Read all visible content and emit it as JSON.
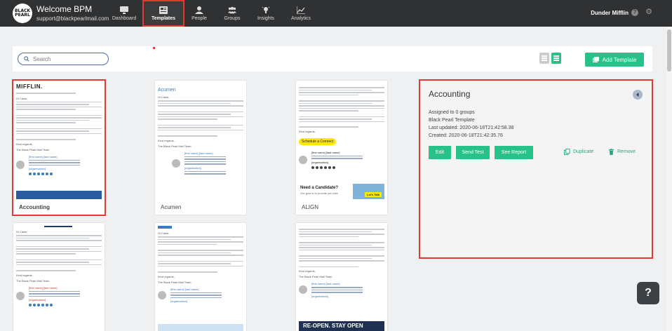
{
  "header": {
    "logo_text": "BLACK PEARL",
    "welcome": "Welcome BPM",
    "email": "support@blackpearlmail.com",
    "nav": [
      {
        "label": "Dashboard",
        "icon": "monitor-icon"
      },
      {
        "label": "Templates",
        "icon": "template-icon",
        "active": true
      },
      {
        "label": "People",
        "icon": "person-icon"
      },
      {
        "label": "Groups",
        "icon": "groups-icon"
      },
      {
        "label": "Insights",
        "icon": "lightbulb-icon"
      },
      {
        "label": "Analytics",
        "icon": "chart-line-icon"
      }
    ],
    "org": "Dunder Mifflin",
    "help": "?",
    "settings_icon": "gear-icon"
  },
  "toolbar": {
    "search_placeholder": "Search",
    "add_label": "Add Template",
    "view_modes": [
      "list-view",
      "grid-view"
    ],
    "active_view": "grid-view"
  },
  "templates": [
    {
      "name": "Accounting",
      "logo": "MIFFLIN.",
      "selected": true
    },
    {
      "name": "Acumen",
      "logo": "Acumen"
    },
    {
      "name": "ALIGN",
      "cta": "Schedule a Connect",
      "promo": "Need a Candidate?",
      "promo_sub": "Our goal is to provide you with",
      "promo_btn": "Let's Talk"
    },
    {
      "name": "",
      "logo": ""
    },
    {
      "name": "",
      "logo": ""
    },
    {
      "name": "",
      "banner": "RE-OPEN. STAY OPEN"
    }
  ],
  "thumb_text": {
    "greeting": "Hi Claire,",
    "regards": "Kind regards,",
    "team": "The Black Pearl Mail Team",
    "sig_name": "[first name] [last name]",
    "sig_org": "[organisation]"
  },
  "detail": {
    "title": "Accounting",
    "assigned": "Assigned to 0 groups",
    "type": "Black Pearl Template",
    "updated": "Last updated: 2020-06-18T21:42:58.38",
    "created": "Created: 2020-06-18T21:42:35.76",
    "edit": "Edit",
    "send_test": "Send Test",
    "see_report": "See Report",
    "duplicate": "Duplicate",
    "remove": "Remove"
  },
  "help_float": "?",
  "colors": {
    "accent": "#27c28a",
    "topbar": "#2f3133",
    "highlight": "#e53935"
  }
}
